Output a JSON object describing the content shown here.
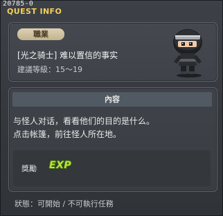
{
  "window": {
    "id_label": "20785-0",
    "title": "QUEST INFO"
  },
  "quest_card": {
    "job_label": "職業",
    "name": "[光之骑士] 难以置信的事实",
    "level_text": "建議等級：15～19",
    "avatar_icon": "ninja-character-icon"
  },
  "content": {
    "header": "內容",
    "lines": [
      "与怪人对话，看看他们的目的是什么。",
      "点击帐篷，前往怪人所在地。"
    ]
  },
  "reward": {
    "label": "獎勵",
    "exp_text": "EXP",
    "exp_color": "#b9e53c"
  },
  "status": {
    "text": "狀態：可開始 / 不可執行任務"
  }
}
